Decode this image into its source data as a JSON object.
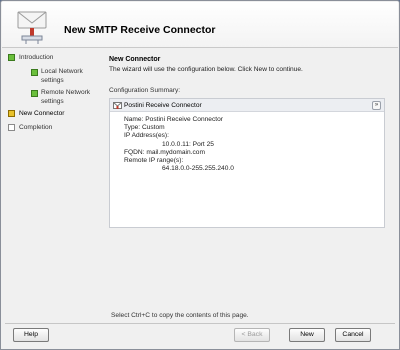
{
  "window": {
    "title": "New SMTP Receive Connector"
  },
  "nav": {
    "items": [
      {
        "label": "Introduction",
        "state": "done"
      },
      {
        "label": "Local Network settings",
        "state": "done",
        "sub": true
      },
      {
        "label": "Remote Network settings",
        "state": "done",
        "sub": true
      },
      {
        "label": "New Connector",
        "state": "current"
      },
      {
        "label": "Completion",
        "state": "pending"
      }
    ]
  },
  "main": {
    "section_title": "New Connector",
    "section_desc": "The wizard will use the configuration below.  Click New to continue.",
    "config_label": "Configuration Summary:",
    "panel": {
      "title": "Postini Receive Connector",
      "collapse_glyph": "»",
      "lines": [
        "Name: Postini Receive Connector",
        "Type: Custom",
        "IP Address(es):",
        "10.0.0.11: Port 25",
        "FQDN: mail.mydomain.com",
        "Remote IP range(s):",
        "64.18.0.0-255.255.240.0"
      ]
    }
  },
  "footer": {
    "hint": "Select Ctrl+C to copy the contents of this page.",
    "help_label": "Help",
    "back_label": "< Back",
    "new_label": "New",
    "cancel_label": "Cancel"
  },
  "colors": {
    "done": "#6abf3b",
    "current": "#e8c12a"
  }
}
